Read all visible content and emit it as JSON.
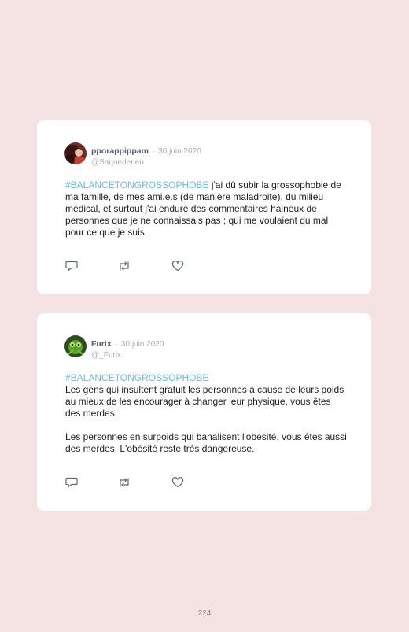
{
  "tweets": [
    {
      "name": "pporappippam",
      "separator": "·",
      "date": "30 juin 2020",
      "handle": "@Saquedeneu",
      "paragraphs": [
        {
          "hashtag": "#BALANCETONGROSSOPHOBE",
          "text": " j'ai dû subir la grossophobie de ma famille, de mes ami.e.s (de manière maladroite), du milieu médical, et surtout j'ai enduré des commentaires haineux de personnes que je ne connaissais pas ; qui me voulaient du mal pour ce que je suis."
        }
      ]
    },
    {
      "name": "Furix",
      "separator": "·",
      "date": "30 juin 2020",
      "handle": "@_Furix",
      "paragraphs": [
        {
          "hashtag": "#BALANCETONGROSSOPHOBE",
          "text": "Les gens qui insultent gratuit les personnes à cause de leurs poids au mieux de les encourager à changer leur physique, vous êtes des merdes."
        },
        {
          "text": "Les personnes en surpoids qui banalisent l'obésité, vous êtes aussi des merdes. L'obésité reste très dangereuse."
        }
      ]
    }
  ],
  "page_number": "224",
  "colors": {
    "background": "#f5e3e3",
    "card": "#ffffff",
    "hashtag": "#6cb9e0",
    "icon": "#5b6670"
  }
}
